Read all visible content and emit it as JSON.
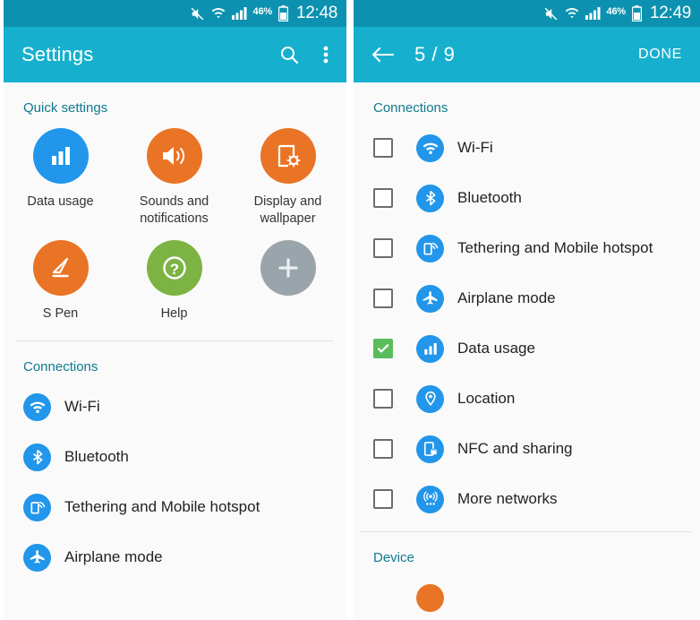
{
  "left": {
    "statusbar": {
      "mute_icon": "mute-icon",
      "wifi_icon": "wifi-download-icon",
      "signal_icon": "signal-bars-icon",
      "battery_percent": "46%",
      "battery_icon": "battery-icon",
      "clock": "12:48"
    },
    "appbar": {
      "title": "Settings",
      "search_icon": "search-icon",
      "overflow_icon": "overflow-menu-icon"
    },
    "quick_settings": {
      "header": "Quick settings",
      "items": [
        {
          "label": "Data usage",
          "icon": "bar-chart-icon",
          "color": "#2196ea"
        },
        {
          "label": "Sounds and\nnotifications",
          "icon": "speaker-icon",
          "color": "#e97425"
        },
        {
          "label": "Display and\nwallpaper",
          "icon": "display-brightness-icon",
          "color": "#e97425"
        },
        {
          "label": "S Pen",
          "icon": "pen-icon",
          "color": "#e97425"
        },
        {
          "label": "Help",
          "icon": "question-mark-icon",
          "color": "#7cb342"
        },
        {
          "label": "",
          "icon": "plus-icon",
          "color": "#9aa5ab"
        }
      ]
    },
    "connections": {
      "header": "Connections",
      "items": [
        {
          "label": "Wi-Fi",
          "icon": "wifi-icon"
        },
        {
          "label": "Bluetooth",
          "icon": "bluetooth-icon"
        },
        {
          "label": "Tethering and Mobile hotspot",
          "icon": "tethering-icon"
        },
        {
          "label": "Airplane mode",
          "icon": "airplane-icon"
        }
      ]
    }
  },
  "right": {
    "statusbar": {
      "mute_icon": "mute-icon",
      "wifi_icon": "wifi-download-icon",
      "signal_icon": "signal-bars-icon",
      "battery_percent": "46%",
      "battery_icon": "battery-icon",
      "clock": "12:49"
    },
    "appbar": {
      "back_icon": "back-arrow-icon",
      "counter": "5 / 9",
      "done_label": "DONE"
    },
    "connections": {
      "header": "Connections",
      "items": [
        {
          "label": "Wi-Fi",
          "icon": "wifi-icon",
          "checked": false
        },
        {
          "label": "Bluetooth",
          "icon": "bluetooth-icon",
          "checked": false
        },
        {
          "label": "Tethering and Mobile hotspot",
          "icon": "tethering-icon",
          "checked": false
        },
        {
          "label": "Airplane mode",
          "icon": "airplane-icon",
          "checked": false
        },
        {
          "label": "Data usage",
          "icon": "bar-chart-icon",
          "checked": true
        },
        {
          "label": "Location",
          "icon": "location-pin-icon",
          "checked": false
        },
        {
          "label": "NFC and sharing",
          "icon": "nfc-icon",
          "checked": false
        },
        {
          "label": "More networks",
          "icon": "more-networks-icon",
          "checked": false
        }
      ]
    },
    "device": {
      "header": "Device"
    }
  },
  "colors": {
    "statusbar": "#0c92b0",
    "appbar": "#16b0ce",
    "section_title": "#10798f",
    "icon_blue": "#2196ea",
    "icon_orange": "#e97425",
    "icon_green": "#7cb342",
    "icon_gray": "#9aa5ab",
    "checkbox_checked": "#5bbc5b",
    "page_bg": "#fafafa"
  }
}
